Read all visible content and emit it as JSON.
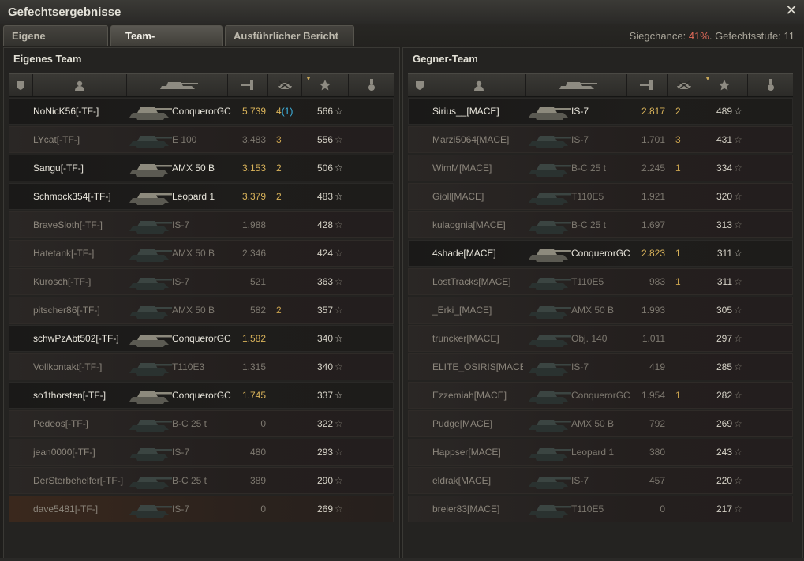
{
  "window": {
    "title": "Gefechtsergebnisse",
    "close_icon": "close-icon"
  },
  "tabs": [
    {
      "label": "Eigene Auswertung",
      "active": false
    },
    {
      "label": "Team-Auswertung",
      "active": true
    },
    {
      "label": "Ausführlicher Bericht",
      "active": false
    }
  ],
  "battle_info": {
    "win_chance_label": "Siegchance:",
    "win_chance_value": "41%",
    "tier_label": ". Gefechtsstufe: 11"
  },
  "colors": {
    "alive_gold": "#d9b35a",
    "accent_red": "#e46c5b",
    "blue": "#3fb7e6"
  },
  "columns": [
    "shield-icon",
    "player-icon",
    "tank-icon",
    "gun-icon",
    "kills-icon",
    "xp-star-icon",
    "medal-icon"
  ],
  "own_team": {
    "title": "Eigenes Team",
    "players": [
      {
        "name": "NoNicK56[-TF-]",
        "vehicle": "ConquerorGC",
        "damage": "5.739",
        "kills": "4",
        "kills_extra": "(1)",
        "xp": "566",
        "alive": true,
        "self": false
      },
      {
        "name": "LYcat[-TF-]",
        "vehicle": "E 100",
        "damage": "3.483",
        "kills": "3",
        "kills_extra": "",
        "xp": "556",
        "alive": false,
        "self": false
      },
      {
        "name": "Sangu[-TF-]",
        "vehicle": "AMX 50 B",
        "damage": "3.153",
        "kills": "2",
        "kills_extra": "",
        "xp": "506",
        "alive": true,
        "self": false
      },
      {
        "name": "Schmock354[-TF-]",
        "vehicle": "Leopard 1",
        "damage": "3.379",
        "kills": "2",
        "kills_extra": "",
        "xp": "483",
        "alive": true,
        "self": false
      },
      {
        "name": "BraveSloth[-TF-]",
        "vehicle": "IS-7",
        "damage": "1.988",
        "kills": "",
        "kills_extra": "",
        "xp": "428",
        "alive": false,
        "self": false
      },
      {
        "name": "Hatetank[-TF-]",
        "vehicle": "AMX 50 B",
        "damage": "2.346",
        "kills": "",
        "kills_extra": "",
        "xp": "424",
        "alive": false,
        "self": false
      },
      {
        "name": "Kurosch[-TF-]",
        "vehicle": "IS-7",
        "damage": "521",
        "kills": "",
        "kills_extra": "",
        "xp": "363",
        "alive": false,
        "self": false
      },
      {
        "name": "pitscher86[-TF-]",
        "vehicle": "AMX 50 B",
        "damage": "582",
        "kills": "2",
        "kills_extra": "",
        "xp": "357",
        "alive": false,
        "self": false
      },
      {
        "name": "schwPzAbt502[-TF-]",
        "vehicle": "ConquerorGC",
        "damage": "1.582",
        "kills": "",
        "kills_extra": "",
        "xp": "340",
        "alive": true,
        "self": false
      },
      {
        "name": "Vollkontakt[-TF-]",
        "vehicle": "T110E3",
        "damage": "1.315",
        "kills": "",
        "kills_extra": "",
        "xp": "340",
        "alive": false,
        "self": false
      },
      {
        "name": "so1thorsten[-TF-]",
        "vehicle": "ConquerorGC",
        "damage": "1.745",
        "kills": "",
        "kills_extra": "",
        "xp": "337",
        "alive": true,
        "self": false
      },
      {
        "name": "Pedeos[-TF-]",
        "vehicle": "B-C 25 t",
        "damage": "0",
        "kills": "",
        "kills_extra": "",
        "xp": "322",
        "alive": false,
        "self": false
      },
      {
        "name": "jean0000[-TF-]",
        "vehicle": "IS-7",
        "damage": "480",
        "kills": "",
        "kills_extra": "",
        "xp": "293",
        "alive": false,
        "self": false
      },
      {
        "name": "DerSterbehelfer[-TF-]",
        "vehicle": "B-C 25 t",
        "damage": "389",
        "kills": "",
        "kills_extra": "",
        "xp": "290",
        "alive": false,
        "self": false
      },
      {
        "name": "dave5481[-TF-]",
        "vehicle": "IS-7",
        "damage": "0",
        "kills": "",
        "kills_extra": "",
        "xp": "269",
        "alive": false,
        "self": true
      }
    ]
  },
  "enemy_team": {
    "title": "Gegner-Team",
    "players": [
      {
        "name": "Sirius__[MACE]",
        "vehicle": "IS-7",
        "damage": "2.817",
        "kills": "2",
        "kills_extra": "",
        "xp": "489",
        "alive": true,
        "self": false
      },
      {
        "name": "Marzi5064[MACE]",
        "vehicle": "IS-7",
        "damage": "1.701",
        "kills": "3",
        "kills_extra": "",
        "xp": "431",
        "alive": false,
        "self": false
      },
      {
        "name": "WimM[MACE]",
        "vehicle": "B-C 25 t",
        "damage": "2.245",
        "kills": "1",
        "kills_extra": "",
        "xp": "334",
        "alive": false,
        "self": false
      },
      {
        "name": "Gioll[MACE]",
        "vehicle": "T110E5",
        "damage": "1.921",
        "kills": "",
        "kills_extra": "",
        "xp": "320",
        "alive": false,
        "self": false
      },
      {
        "name": "kulaognia[MACE]",
        "vehicle": "B-C 25 t",
        "damage": "1.697",
        "kills": "",
        "kills_extra": "",
        "xp": "313",
        "alive": false,
        "self": false
      },
      {
        "name": "4shade[MACE]",
        "vehicle": "ConquerorGC",
        "damage": "2.823",
        "kills": "1",
        "kills_extra": "",
        "xp": "311",
        "alive": true,
        "self": false
      },
      {
        "name": "LostTracks[MACE]",
        "vehicle": "T110E5",
        "damage": "983",
        "kills": "1",
        "kills_extra": "",
        "xp": "311",
        "alive": false,
        "self": false
      },
      {
        "name": "_Erki_[MACE]",
        "vehicle": "AMX 50 B",
        "damage": "1.993",
        "kills": "",
        "kills_extra": "",
        "xp": "305",
        "alive": false,
        "self": false
      },
      {
        "name": "truncker[MACE]",
        "vehicle": "Obj. 140",
        "damage": "1.011",
        "kills": "",
        "kills_extra": "",
        "xp": "297",
        "alive": false,
        "self": false
      },
      {
        "name": "ELITE_OSIRIS[MACE]",
        "vehicle": "IS-7",
        "damage": "419",
        "kills": "",
        "kills_extra": "",
        "xp": "285",
        "alive": false,
        "self": false
      },
      {
        "name": "Ezzemiah[MACE]",
        "vehicle": "ConquerorGC",
        "damage": "1.954",
        "kills": "1",
        "kills_extra": "",
        "xp": "282",
        "alive": false,
        "self": false
      },
      {
        "name": "Pudge[MACE]",
        "vehicle": "AMX 50 B",
        "damage": "792",
        "kills": "",
        "kills_extra": "",
        "xp": "269",
        "alive": false,
        "self": false
      },
      {
        "name": "Happser[MACE]",
        "vehicle": "Leopard 1",
        "damage": "380",
        "kills": "",
        "kills_extra": "",
        "xp": "243",
        "alive": false,
        "self": false
      },
      {
        "name": "eldrak[MACE]",
        "vehicle": "IS-7",
        "damage": "457",
        "kills": "",
        "kills_extra": "",
        "xp": "220",
        "alive": false,
        "self": false
      },
      {
        "name": "breier83[MACE]",
        "vehicle": "T110E5",
        "damage": "0",
        "kills": "",
        "kills_extra": "",
        "xp": "217",
        "alive": false,
        "self": false
      }
    ]
  },
  "xp_star_glyph": "☆"
}
